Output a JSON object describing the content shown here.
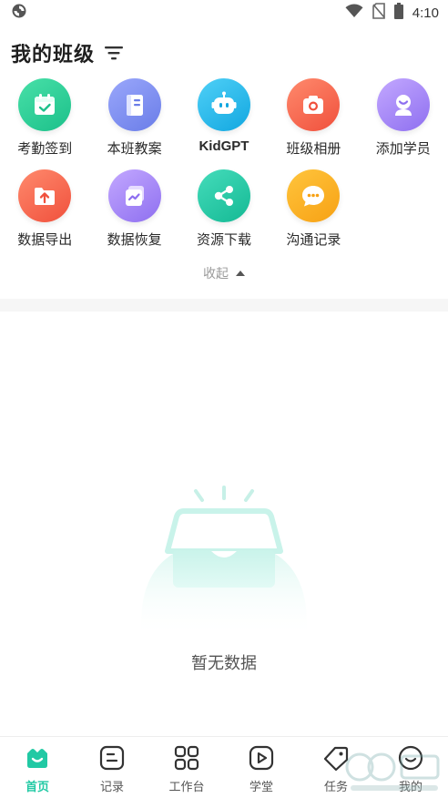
{
  "status_bar": {
    "time": "4:10"
  },
  "header": {
    "title": "我的班级"
  },
  "grid": {
    "items": [
      {
        "label": "考勤签到",
        "icon": "attendance-calendar-icon",
        "color": "#2bd19a"
      },
      {
        "label": "本班教案",
        "icon": "lesson-plan-book-icon",
        "color": "#7b8cf2"
      },
      {
        "label": "KidGPT",
        "icon": "robot-icon",
        "color": "#1fb7ea"
      },
      {
        "label": "班级相册",
        "icon": "camera-icon",
        "color": "#f5644f"
      },
      {
        "label": "添加学员",
        "icon": "add-student-icon",
        "color": "#9b7cf0"
      },
      {
        "label": "数据导出",
        "icon": "data-export-folder-icon",
        "color": "#f5644f"
      },
      {
        "label": "数据恢复",
        "icon": "data-recovery-icon",
        "color": "#9b7cf0"
      },
      {
        "label": "资源下载",
        "icon": "share-nodes-icon",
        "color": "#22c9a6"
      },
      {
        "label": "沟通记录",
        "icon": "chat-bubble-icon",
        "color": "#f9a91c"
      }
    ],
    "collapse_label": "收起"
  },
  "empty_state": {
    "text": "暂无数据"
  },
  "bottom_nav": {
    "items": [
      {
        "label": "首页",
        "icon": "home-icon",
        "active": true
      },
      {
        "label": "记录",
        "icon": "record-icon",
        "active": false
      },
      {
        "label": "工作台",
        "icon": "workbench-grid-icon",
        "active": false
      },
      {
        "label": "学堂",
        "icon": "video-play-icon",
        "active": false
      },
      {
        "label": "任务",
        "icon": "task-tag-icon",
        "active": false
      },
      {
        "label": "我的",
        "icon": "profile-icon",
        "active": false
      }
    ]
  },
  "colors": {
    "accent": "#21c9a4"
  }
}
